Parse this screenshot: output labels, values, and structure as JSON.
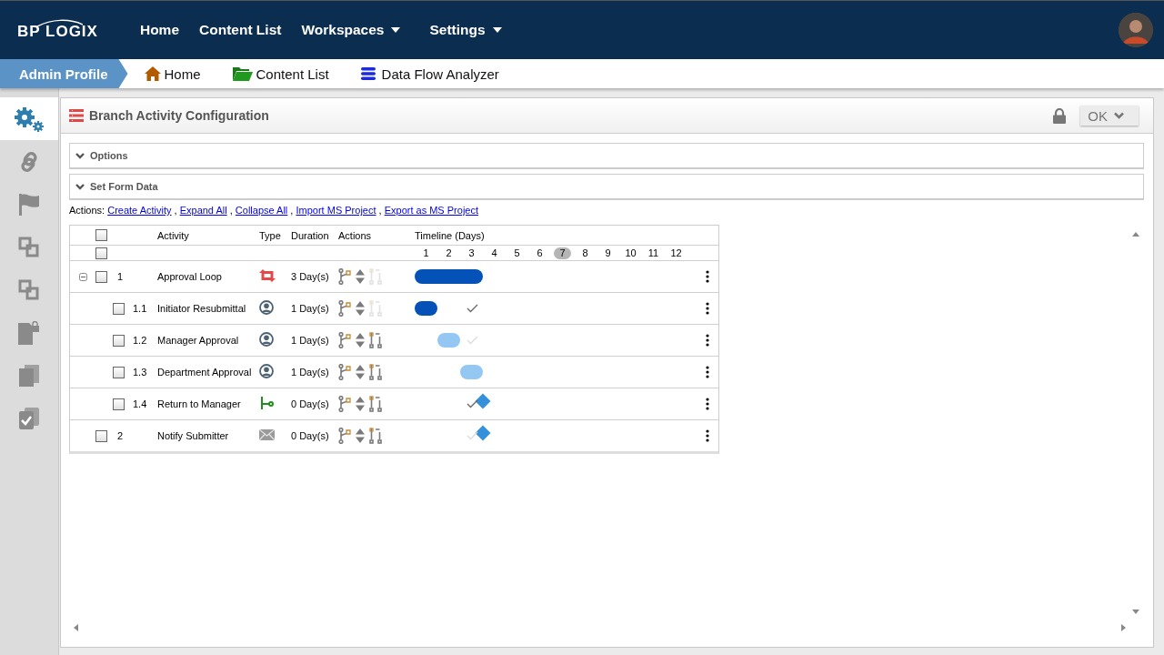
{
  "top_nav": {
    "logo": "BP LOGIX",
    "items": [
      {
        "label": "Home",
        "has_menu": false
      },
      {
        "label": "Content List",
        "has_menu": false
      },
      {
        "label": "Workspaces",
        "has_menu": true
      },
      {
        "label": "Settings",
        "has_menu": true
      }
    ]
  },
  "breadcrumb": {
    "profile": "Admin Profile",
    "links": [
      {
        "label": "Home",
        "kind": "home"
      },
      {
        "label": "Content List",
        "kind": "folder"
      },
      {
        "label": "Data Flow Analyzer",
        "kind": "database"
      }
    ]
  },
  "sidebar": [
    {
      "kind": "gears",
      "selected": true
    },
    {
      "kind": "link",
      "selected": false
    },
    {
      "kind": "flag",
      "selected": false
    },
    {
      "kind": "copy",
      "selected": false
    },
    {
      "kind": "copy",
      "selected": false
    },
    {
      "kind": "locked-doc",
      "selected": false
    },
    {
      "kind": "pages",
      "selected": false
    },
    {
      "kind": "checked-doc",
      "selected": false
    }
  ],
  "panel": {
    "title": "Branch Activity Configuration",
    "locked": true,
    "ok_button": "OK",
    "sections": [
      {
        "label": "Options"
      },
      {
        "label": "Set Form Data"
      }
    ],
    "actions_label": "Actions:",
    "actions": [
      {
        "label": "Create Activity"
      },
      {
        "separator": ",",
        "label": "Expand All"
      },
      {
        "separator": ",",
        "label": "Collapse All"
      },
      {
        "separator": ",",
        "label": "Import MS Project"
      },
      {
        "separator": ",",
        "label": "Export as MS Project"
      }
    ],
    "table": {
      "columns": [
        "Activity",
        "Type",
        "Duration",
        "Actions",
        "Timeline (Days)"
      ],
      "header_checked": false,
      "subheader_checked": false,
      "timeline_days": [
        {
          "label": "1",
          "selected": false
        },
        {
          "label": "2",
          "selected": false
        },
        {
          "label": "3",
          "selected": false
        },
        {
          "label": "4",
          "selected": false
        },
        {
          "label": "5",
          "selected": false
        },
        {
          "label": "6",
          "selected": false
        },
        {
          "label": "7",
          "selected": true
        },
        {
          "label": "8",
          "selected": false
        },
        {
          "label": "9",
          "selected": false
        },
        {
          "label": "10",
          "selected": false
        },
        {
          "label": "11",
          "selected": false
        },
        {
          "label": "12",
          "selected": false
        }
      ],
      "rows": [
        {
          "number": "1",
          "activity": "Approval Loop",
          "kind": "loop",
          "duration": "3 Day(s)",
          "checked": false,
          "link_disabled": true,
          "expanded": true,
          "color": "#0452b8",
          "children": [
            {
              "number": "1.1",
              "activity": "Initiator Resubmittal",
              "kind": "user",
              "duration": "1 Day(s)",
              "checked": false,
              "link_disabled": true,
              "color": "#0452b8",
              "checkmark": {
                "faint": false
              }
            },
            {
              "number": "1.2",
              "activity": "Manager Approval",
              "kind": "user",
              "duration": "1 Day(s)",
              "checked": false,
              "link_disabled": false,
              "color": "#94c8f2",
              "checkmark": {
                "faint": true
              }
            },
            {
              "number": "1.3",
              "activity": "Department Approval",
              "kind": "user",
              "duration": "1 Day(s)",
              "checked": false,
              "link_disabled": false,
              "color": "#94c8f2"
            },
            {
              "number": "1.4",
              "activity": "Return to Manager",
              "kind": "branch",
              "duration": "0 Day(s)",
              "checked": false,
              "link_disabled": false,
              "color": "#3590dc",
              "checkmark": {
                "faint": false
              }
            }
          ]
        },
        {
          "number": "2",
          "activity": "Notify Submitter",
          "kind": "email",
          "duration": "0 Day(s)",
          "checked": false,
          "link_disabled": false,
          "color": "#3590dc",
          "checkmark": {
            "faint": true
          }
        }
      ]
    }
  }
}
